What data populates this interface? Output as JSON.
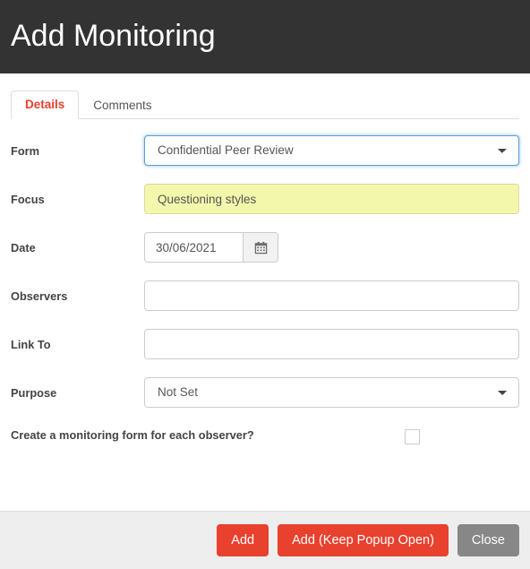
{
  "header": {
    "title": "Add Monitoring"
  },
  "tabs": [
    {
      "label": "Details",
      "active": true
    },
    {
      "label": "Comments",
      "active": false
    }
  ],
  "form": {
    "rows": [
      {
        "label": "Form",
        "type": "select",
        "value": "Confidential Peer Review",
        "focused": true
      },
      {
        "label": "Focus",
        "type": "text",
        "value": "Questioning styles",
        "autofill": true
      },
      {
        "label": "Date",
        "type": "date",
        "value": "30/06/2021",
        "button_icon": "calendar-icon"
      },
      {
        "label": "Observers",
        "type": "text",
        "value": "",
        "placeholder": ""
      },
      {
        "label": "Link To",
        "type": "text",
        "value": "",
        "placeholder": ""
      },
      {
        "label": "Purpose",
        "type": "select",
        "value": "Not Set"
      }
    ],
    "checkbox_row": {
      "label": "Create a monitoring form for each observer?",
      "checked": false
    }
  },
  "footer": {
    "buttons": [
      {
        "label": "Add",
        "style": "danger"
      },
      {
        "label": "Add (Keep Popup Open)",
        "style": "danger"
      },
      {
        "label": "Close",
        "style": "default"
      }
    ]
  },
  "colors": {
    "header_bg": "#333333",
    "accent_red": "#e8412e",
    "close_gray": "#878787",
    "footer_bg": "#eeeeee",
    "autofill_yellow": "#f3f7ab",
    "focus_blue": "#5b9dd9",
    "border_gray": "#cccccc"
  }
}
